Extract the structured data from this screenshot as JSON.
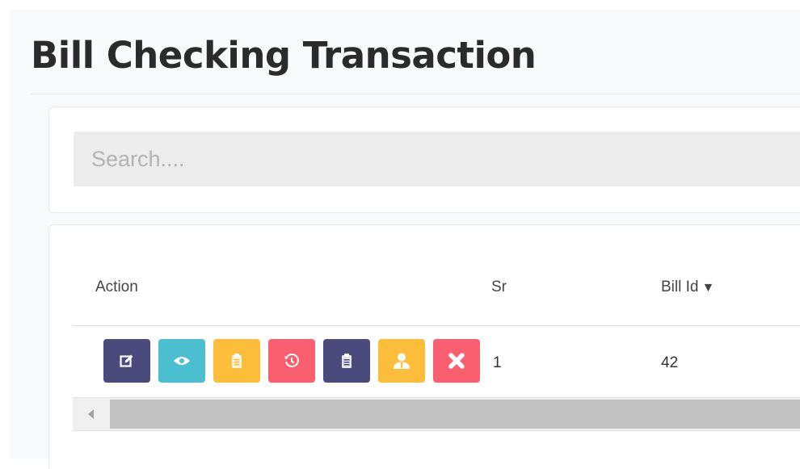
{
  "page": {
    "title": "Bill Checking Transaction"
  },
  "search": {
    "placeholder": "Search...."
  },
  "table": {
    "columns": {
      "action": "Action",
      "sr": "Sr",
      "bill_id": "Bill Id",
      "bill_id_sort_indicator": "▼"
    },
    "rows": [
      {
        "sr": "1",
        "bill_id": "42"
      }
    ]
  },
  "action_buttons": [
    {
      "icon": "edit-icon",
      "color": "#4a4b7c"
    },
    {
      "icon": "eye-icon",
      "color": "#4bbfcf"
    },
    {
      "icon": "clipboard-icon",
      "color": "#fcbd3a"
    },
    {
      "icon": "history-icon",
      "color": "#fa5f6f"
    },
    {
      "icon": "clipboard-list-icon",
      "color": "#4a4b7c"
    },
    {
      "icon": "user-icon",
      "color": "#fcbd3a"
    },
    {
      "icon": "close-icon",
      "color": "#fa5f6f"
    }
  ]
}
